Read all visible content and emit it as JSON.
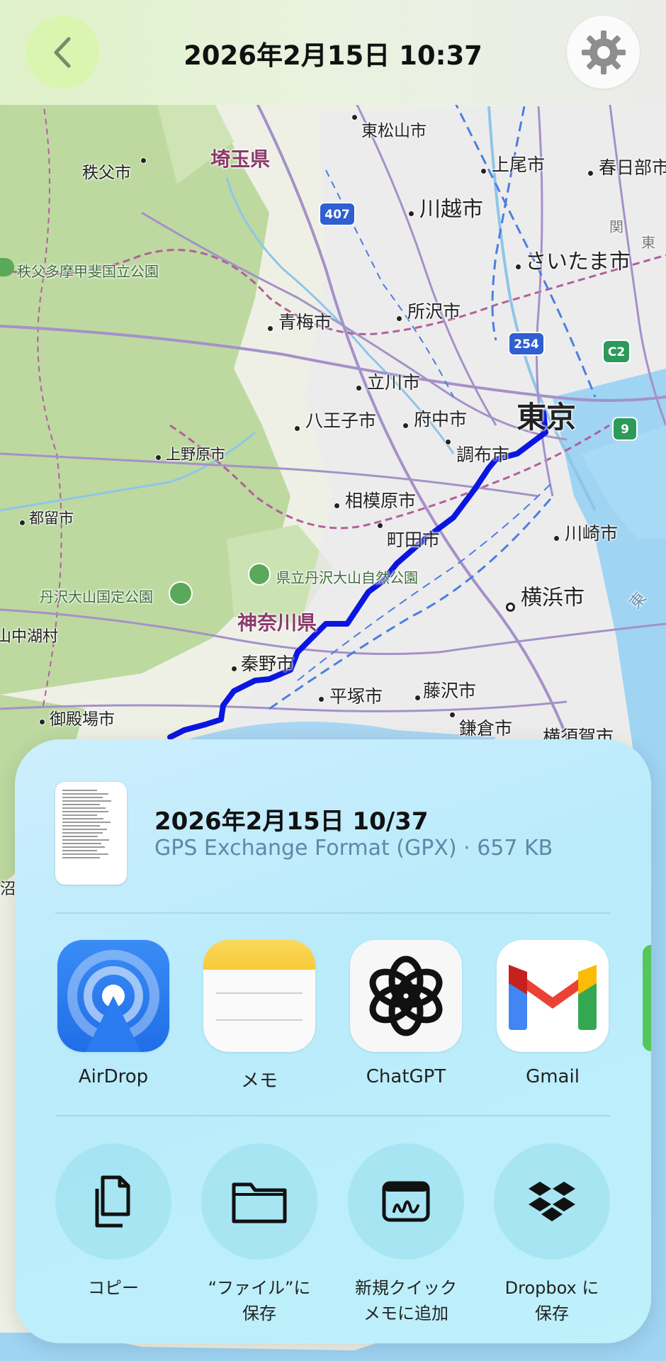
{
  "header": {
    "title": "2026年2月15日 10:37"
  },
  "map": {
    "prefectures": [
      "埼玉県",
      "神奈川県"
    ],
    "capital": "東京",
    "cities": [
      "東松山市",
      "秩父市",
      "上尾市",
      "春日部市",
      "川越市",
      "さいたま市",
      "青梅市",
      "所沢市",
      "立川市",
      "八王子市",
      "府中市",
      "調布市",
      "上野原市",
      "相模原市",
      "都留市",
      "町田市",
      "川崎市",
      "横浜市",
      "秦野市",
      "平塚市",
      "藤沢市",
      "御殿場市",
      "鎌倉市",
      "横須賀市",
      "山中湖村"
    ],
    "parks": [
      "秩父多摩甲斐国立公園",
      "県立丹沢大山自然公園",
      "丹沢大山国定公園"
    ],
    "routes": [
      "407",
      "254",
      "C2",
      "9"
    ],
    "region_fragments": [
      "関",
      "東",
      "東",
      "沼"
    ],
    "route_color": "#0a16e0"
  },
  "share_sheet": {
    "file_name": "2026年2月15日 10/37",
    "file_meta": "GPS Exchange Format (GPX) · 657 KB",
    "apps": [
      {
        "label": "AirDrop",
        "icon": "airdrop-icon"
      },
      {
        "label": "メモ",
        "icon": "notes-icon"
      },
      {
        "label": "ChatGPT",
        "icon": "chatgpt-icon"
      },
      {
        "label": "Gmail",
        "icon": "gmail-icon"
      }
    ],
    "actions": [
      {
        "label": "コピー",
        "icon": "copy-icon"
      },
      {
        "label": "“ファイル”に\n保存",
        "icon": "folder-icon"
      },
      {
        "label": "新規クイック\nメモに追加",
        "icon": "quick-note-icon"
      },
      {
        "label": "Dropbox に\n保存",
        "icon": "dropbox-icon"
      }
    ]
  },
  "colors": {
    "back_button": "#d9f5b0",
    "sheet": "#bfeefb",
    "meta_text": "#5e88a8"
  }
}
